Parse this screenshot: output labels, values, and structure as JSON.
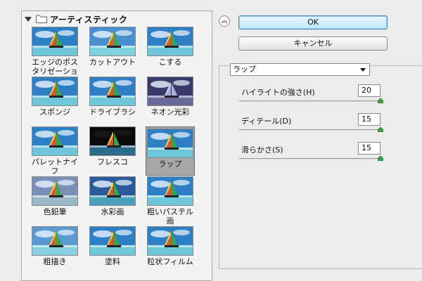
{
  "gallery": {
    "group_label": "アーティスティック",
    "items": [
      {
        "label": "エッジのポスタリゼーション",
        "id": "poster-edges",
        "style": "poster"
      },
      {
        "label": "カットアウト",
        "id": "cutout",
        "style": "cutout"
      },
      {
        "label": "こする",
        "id": "smudge",
        "style": "normal"
      },
      {
        "label": "スポンジ",
        "id": "sponge",
        "style": "sponge"
      },
      {
        "label": "ドライブラシ",
        "id": "drybrush",
        "style": "normal"
      },
      {
        "label": "ネオン光彩",
        "id": "neon",
        "style": "neon"
      },
      {
        "label": "パレットナイフ",
        "id": "palette-knife",
        "style": "normal"
      },
      {
        "label": "フレスコ",
        "id": "fresco",
        "style": "fresco"
      },
      {
        "label": "ラップ",
        "id": "plastic-wrap",
        "style": "normal",
        "selected": true
      },
      {
        "label": "色鉛筆",
        "id": "colored-pencil",
        "style": "pencil"
      },
      {
        "label": "水彩画",
        "id": "watercolor",
        "style": "watercolor"
      },
      {
        "label": "粗いパステル画",
        "id": "rough-pastels",
        "style": "pastel"
      },
      {
        "label": "粗描き",
        "id": "underpainting",
        "style": "soft"
      },
      {
        "label": "塗料",
        "id": "paint-daubs",
        "style": "daubs"
      },
      {
        "label": "粒状フィルム",
        "id": "film-grain",
        "style": "grain"
      }
    ]
  },
  "buttons": {
    "collapse_glyph": "︽",
    "ok_label": "OK",
    "cancel_label": "キャンセル"
  },
  "filter_select": {
    "value": "ラップ"
  },
  "params": [
    {
      "label": "ハイライトの強さ(H)",
      "value": "20",
      "fraction": 1.0
    },
    {
      "label": "ディテール(D)",
      "value": "15",
      "fraction": 1.0
    },
    {
      "label": "滑らかさ(S)",
      "value": "15",
      "fraction": 1.0
    }
  ],
  "colors": {
    "sky": "#2f7fc4",
    "sea": "#6ec6d8",
    "thumb_green": "#3aa64a"
  }
}
